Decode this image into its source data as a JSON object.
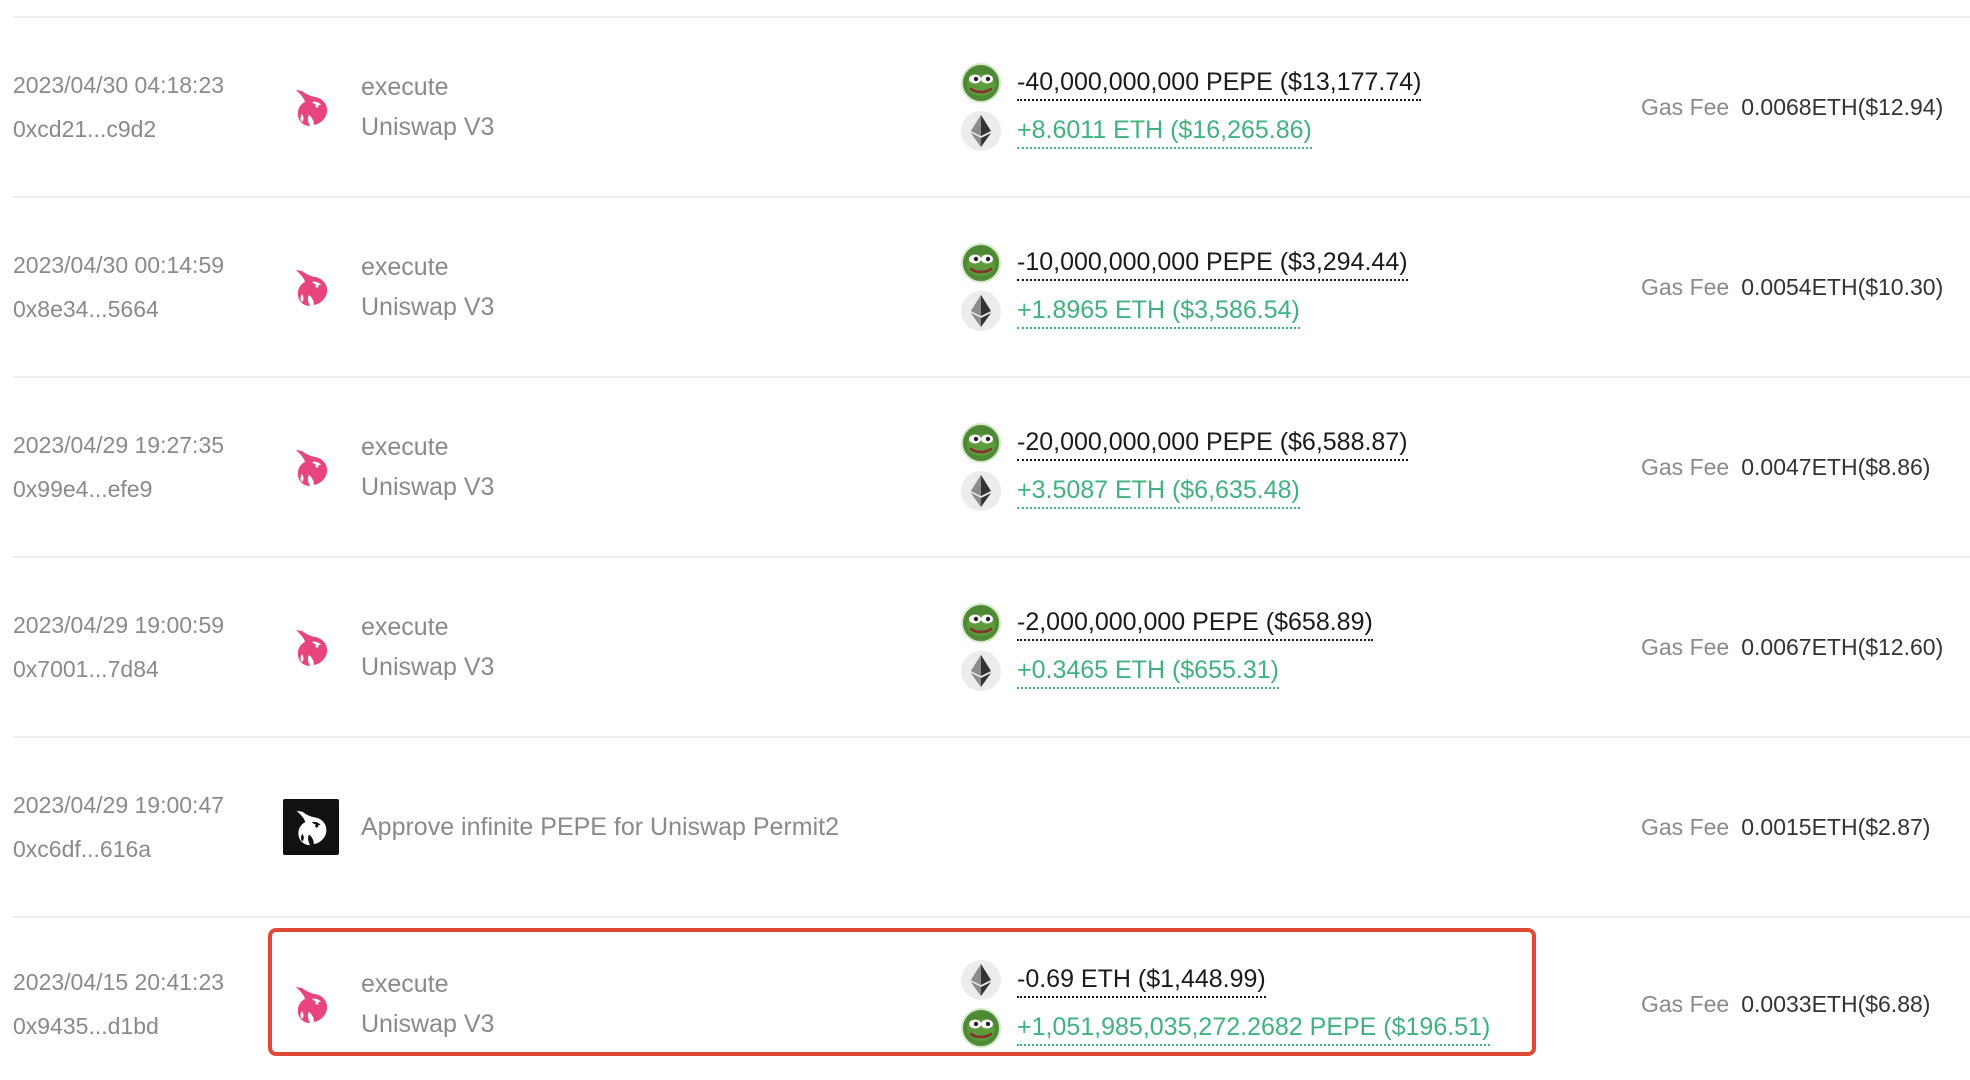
{
  "gas_label": "Gas Fee",
  "colors": {
    "incoming": "#3fb27f",
    "outgoing": "#1a1a1a",
    "muted": "#8a8a8a",
    "uniswap_pink": "#e8457f",
    "highlight": "#e04a34"
  },
  "transactions": [
    {
      "time": "2023/04/30 04:18:23",
      "hash": "0xcd21...c9d2",
      "method": "execute",
      "app": "Uniswap V3",
      "icon": "uniswap-unicorn-icon",
      "transfers": [
        {
          "token": "PEPE",
          "icon": "pepe-token-icon",
          "direction": "out",
          "amount": "-40,000,000,000 PEPE ($13,177.74)"
        },
        {
          "token": "ETH",
          "icon": "eth-token-icon",
          "direction": "in",
          "amount": "+8.6011 ETH ($16,265.86)"
        }
      ],
      "gas_fee": "0.0068ETH($12.94)"
    },
    {
      "time": "2023/04/30 00:14:59",
      "hash": "0x8e34...5664",
      "method": "execute",
      "app": "Uniswap V3",
      "icon": "uniswap-unicorn-icon",
      "transfers": [
        {
          "token": "PEPE",
          "icon": "pepe-token-icon",
          "direction": "out",
          "amount": "-10,000,000,000 PEPE ($3,294.44)"
        },
        {
          "token": "ETH",
          "icon": "eth-token-icon",
          "direction": "in",
          "amount": "+1.8965 ETH ($3,586.54)"
        }
      ],
      "gas_fee": "0.0054ETH($10.30)"
    },
    {
      "time": "2023/04/29 19:27:35",
      "hash": "0x99e4...efe9",
      "method": "execute",
      "app": "Uniswap V3",
      "icon": "uniswap-unicorn-icon",
      "transfers": [
        {
          "token": "PEPE",
          "icon": "pepe-token-icon",
          "direction": "out",
          "amount": "-20,000,000,000 PEPE ($6,588.87)"
        },
        {
          "token": "ETH",
          "icon": "eth-token-icon",
          "direction": "in",
          "amount": "+3.5087 ETH ($6,635.48)"
        }
      ],
      "gas_fee": "0.0047ETH($8.86)"
    },
    {
      "time": "2023/04/29 19:00:59",
      "hash": "0x7001...7d84",
      "method": "execute",
      "app": "Uniswap V3",
      "icon": "uniswap-unicorn-icon",
      "transfers": [
        {
          "token": "PEPE",
          "icon": "pepe-token-icon",
          "direction": "out",
          "amount": "-2,000,000,000 PEPE ($658.89)"
        },
        {
          "token": "ETH",
          "icon": "eth-token-icon",
          "direction": "in",
          "amount": "+0.3465 ETH ($655.31)"
        }
      ],
      "gas_fee": "0.0067ETH($12.60)"
    },
    {
      "time": "2023/04/29 19:00:47",
      "hash": "0xc6df...616a",
      "approve_text": "Approve infinite PEPE for Uniswap Permit2",
      "icon": "uniswap-permit2-icon",
      "transfers": [],
      "gas_fee": "0.0015ETH($2.87)"
    },
    {
      "time": "2023/04/15 20:41:23",
      "hash": "0x9435...d1bd",
      "method": "execute",
      "app": "Uniswap V3",
      "icon": "uniswap-unicorn-icon",
      "highlighted": true,
      "transfers": [
        {
          "token": "ETH",
          "icon": "eth-token-icon",
          "direction": "out",
          "amount": "-0.69 ETH ($1,448.99)"
        },
        {
          "token": "PEPE",
          "icon": "pepe-token-icon",
          "direction": "in",
          "amount": "+1,051,985,035,272.2682 PEPE ($196.51)"
        }
      ],
      "gas_fee": "0.0033ETH($6.88)"
    }
  ]
}
